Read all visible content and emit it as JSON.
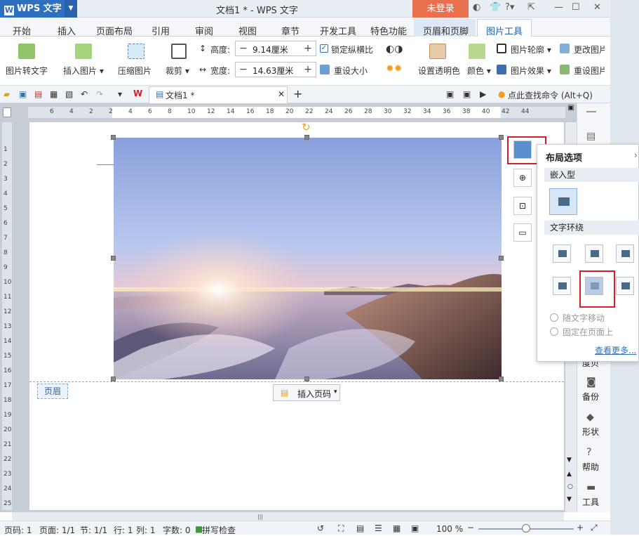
{
  "title_bar": {
    "app_name": "WPS 文字",
    "doc_title": "文档1 * - WPS 文字",
    "login": "未登录",
    "win_min": "—",
    "win_max": "☐",
    "win_close": "✕"
  },
  "tabs": [
    "开始",
    "插入",
    "页面布局",
    "引用",
    "审阅",
    "视图",
    "章节",
    "开发工具",
    "特色功能",
    "页眉和页脚",
    "图片工具"
  ],
  "ribbon": {
    "pic_to_text": "图片转文字",
    "insert_pic": "插入图片",
    "compress": "压缩图片",
    "crop": "裁剪",
    "height_label": "高度:",
    "height_value": "9.14厘米",
    "width_label": "宽度:",
    "width_value": "14.63厘米",
    "lock_ratio": "锁定纵横比",
    "reset_size": "重设大小",
    "set_transparent": "设置透明色",
    "color": "颜色",
    "pic_outline": "图片轮廓",
    "pic_effect": "图片效果",
    "change_pic": "更改图片",
    "reset_pic": "重设图片"
  },
  "quickbar": {
    "doc_tab": "文档1 *",
    "search_cmd": "点此查找命令 (Alt+Q)"
  },
  "ruler": {
    "h_ticks": [
      "6",
      "4",
      "2",
      "2",
      "4",
      "6",
      "8",
      "10",
      "12",
      "14",
      "16",
      "18",
      "20",
      "22",
      "24",
      "26",
      "28",
      "30",
      "32",
      "34",
      "36",
      "38",
      "40",
      "42",
      "44"
    ],
    "v_ticks": [
      "1",
      "2",
      "3",
      "4",
      "5",
      "6",
      "7",
      "8",
      "9",
      "10",
      "11",
      "12",
      "13",
      "14",
      "15",
      "16",
      "17",
      "18",
      "19",
      "20",
      "21",
      "22",
      "23",
      "24",
      "25"
    ]
  },
  "document": {
    "header_tag": "页眉",
    "insert_page_num": "插入页码"
  },
  "layout_panel": {
    "title": "布局选项",
    "inline_section": "嵌入型",
    "wrap_section": "文字环绕",
    "opt_move": "随文字移动",
    "opt_fixed": "固定在页面上",
    "see_more": "查看更多..."
  },
  "sidebar": {
    "backup": "备份",
    "shape": "形状",
    "help": "帮助",
    "tools": "工具",
    "partial": "度贝"
  },
  "statusbar": {
    "page": "页码: 1",
    "pages": "页面: 1/1",
    "section": "节: 1/1",
    "row": "行: 1",
    "col": "列: 1",
    "words": "字数: 0",
    "spell": "拼写检查",
    "zoom": "100 %"
  },
  "colors": {
    "accent": "#2f6fbf",
    "login": "#e8704f",
    "highlight": "#d0202a"
  }
}
